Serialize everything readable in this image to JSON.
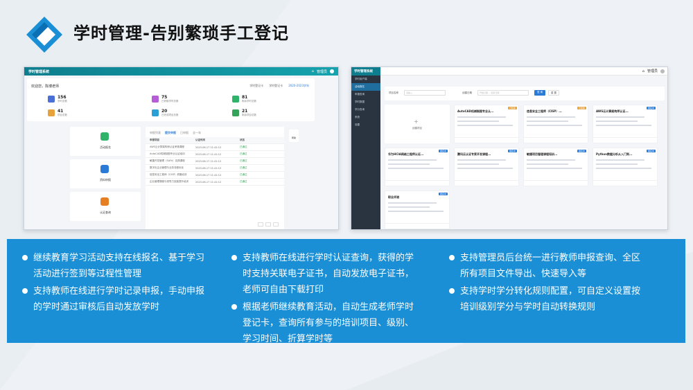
{
  "title": "学时管理-告别繁琐手工登记",
  "colors": {
    "accent": "#1a8fd6",
    "teal": "#0e7e8e"
  },
  "screen1": {
    "brand": "学时管理系统",
    "user": "管理员",
    "welcome": "欢迎您，陈博老师",
    "links": [
      "学时登记卡",
      "学时登记卡",
      "2020-2023学年"
    ],
    "stats": [
      {
        "num": "156",
        "label": "学时总数"
      },
      {
        "num": "75",
        "label": "已获取学时总数"
      },
      {
        "num": "81",
        "label": "剩余学时总数"
      },
      {
        "num": "41",
        "label": "项目总数"
      },
      {
        "num": "20",
        "label": "已完成项目总数"
      },
      {
        "num": "21",
        "label": "剩余项目总数"
      }
    ],
    "side_cards": [
      "活动报名",
      "资料申报",
      "认证查询"
    ],
    "tabs": [
      "申报列表",
      "提交申报",
      "已申报",
      "全一年"
    ],
    "table_header": [
      "申报项目",
      "认证时间",
      "状态"
    ],
    "rows": [
      [
        "AWS云计算架构师认证考核课程",
        "2023-06-17 11:41:12",
        "已通过"
      ],
      [
        "AutoCAD机械制图专业认证培训",
        "2023-06-17 11:41:12",
        "已通过"
      ],
      [
        "敏捷开发管理（SAFe）实践课程",
        "2023-06-17 11:41:12",
        "已通过"
      ],
      [
        "数字化企业管理与业务流程优化",
        "2023-06-17 11:41:12",
        "已通过"
      ],
      [
        "信息安全工程师（CISP）资格培训",
        "2023-06-17 11:41:12",
        "已通过"
      ],
      [
        "企业管理课程与领导力技能提升培训",
        "2023-06-17 11:41:12",
        "已通过"
      ]
    ],
    "side_btn": "帮助"
  },
  "screen2": {
    "brand": "学时管理系统",
    "user": "管理员",
    "menu": [
      "学时用户端",
      "活动报名",
      "申报查询",
      "学时数据",
      "学分查询",
      "系统",
      "设置"
    ],
    "filter": {
      "label1": "项目名称",
      "ph1": "请输入",
      "label2": "创建日期",
      "ph2": "开始日期 ~ 结束日期",
      "search": "查 询",
      "reset": "重 置"
    },
    "add_label": "创建项目",
    "cards": [
      {
        "title": "AutoCAD机械制图专业认...",
        "tag": "已结束"
      },
      {
        "title": "信息安全工程师（CISP）...",
        "tag": "已结束"
      },
      {
        "title": "AWS云计算架构师认证...",
        "tag": "报名中"
      },
      {
        "title": "华为HCIA网络工程师认证...",
        "tag": "报名中"
      },
      {
        "title": "腾讯云认证专家开发课程...",
        "tag": "报名中"
      },
      {
        "title": "敏捷项目管理课程培训...",
        "tag": "报名中"
      },
      {
        "title": "Python数据分析从入门到...",
        "tag": "报名中"
      },
      {
        "title": "职业评测",
        "tag": "报名中"
      }
    ]
  },
  "features": {
    "col1": [
      "继续教育学习活动支持在线报名、基于学习活动进行签到等过程性管理",
      "支持教师在线进行学时记录申报，手动申报的学时通过审核后自动发放学时"
    ],
    "col2": [
      "支持教师在线进行学时认证查询，获得的学时支持关联电子证书，自动发放电子证书，老师可自由下载打印",
      "根据老师继续教育活动，自动生成老师学时登记卡，查询所有参与的培训项目、级别、学习时间、折算学时等"
    ],
    "col3": [
      "支持管理员后台统一进行教师申报查询、全区所有项目文件导出、快速导入等",
      "支持学时学分转化规则配置，可自定义设置按培训级别学分与学时自动转换规则"
    ]
  }
}
